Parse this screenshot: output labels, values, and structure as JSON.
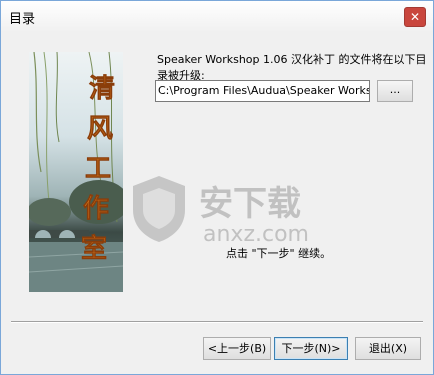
{
  "window": {
    "title": "目录",
    "close_glyph": "✕"
  },
  "description": "Speaker Workshop 1.06 汉化补丁 的文件将在以下目录被升级:",
  "path": {
    "value": "C:\\Program Files\\Audua\\Speaker Workshop"
  },
  "browse_label": "...",
  "continue_text": "点击 \"下一步\" 继续。",
  "image": {
    "calligraphy": [
      "清",
      "风",
      "工",
      "作",
      "室"
    ]
  },
  "watermark": {
    "text": "安下载",
    "sub": "anxz.com"
  },
  "buttons": {
    "back": "<上一步(B)",
    "next": "下一步(N)>",
    "exit": "退出(X)"
  }
}
